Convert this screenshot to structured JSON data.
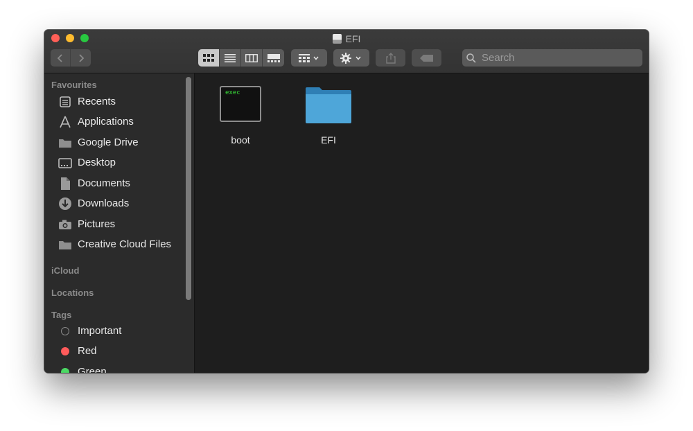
{
  "window": {
    "title": "EFI"
  },
  "toolbar": {
    "search_placeholder": "Search"
  },
  "sidebar": {
    "favourites_title": "Favourites",
    "favourites": [
      {
        "label": "Recents",
        "icon": "clock-icon"
      },
      {
        "label": "Applications",
        "icon": "applications-icon"
      },
      {
        "label": "Google Drive",
        "icon": "folder-icon"
      },
      {
        "label": "Desktop",
        "icon": "desktop-icon"
      },
      {
        "label": "Documents",
        "icon": "documents-icon"
      },
      {
        "label": "Downloads",
        "icon": "download-icon"
      },
      {
        "label": "Pictures",
        "icon": "camera-icon"
      },
      {
        "label": "Creative Cloud Files",
        "icon": "folder-icon"
      }
    ],
    "icloud_title": "iCloud",
    "locations_title": "Locations",
    "tags_title": "Tags",
    "tags": [
      {
        "label": "Important",
        "color": "transparent"
      },
      {
        "label": "Red",
        "color": "#ff5b5b"
      },
      {
        "label": "Green",
        "color": "#4cd964"
      }
    ]
  },
  "files": [
    {
      "name": "boot",
      "type": "exec",
      "badge": "exec"
    },
    {
      "name": "EFI",
      "type": "folder"
    }
  ],
  "colors": {
    "folder": "#4ea6d9",
    "exec_text": "#3be03b"
  }
}
